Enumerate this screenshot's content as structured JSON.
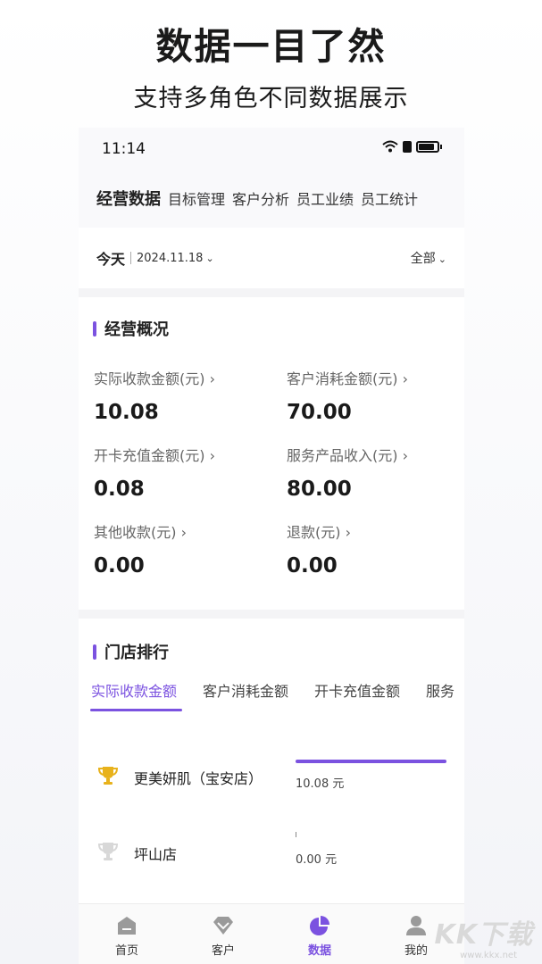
{
  "promo": {
    "title": "数据一目了然",
    "subtitle": "支持多角色不同数据展示"
  },
  "status_bar": {
    "time": "11:14",
    "icons": [
      "wifi-icon",
      "lock-icon",
      "battery-icon"
    ]
  },
  "top_tabs": [
    {
      "label": "经营数据",
      "active": true
    },
    {
      "label": "目标管理",
      "active": false
    },
    {
      "label": "客户分析",
      "active": false
    },
    {
      "label": "员工业绩",
      "active": false
    },
    {
      "label": "员工统计",
      "active": false
    }
  ],
  "date_bar": {
    "today": "今天",
    "date": "2024.11.18",
    "filter": "全部"
  },
  "overview": {
    "title": "经营概况",
    "metrics": [
      {
        "label": "实际收款金额(元) ›",
        "value": "10.08"
      },
      {
        "label": "客户消耗金额(元) ›",
        "value": "70.00"
      },
      {
        "label": "开卡充值金额(元) ›",
        "value": "0.08"
      },
      {
        "label": "服务产品收入(元) ›",
        "value": "80.00"
      },
      {
        "label": "其他收款(元) ›",
        "value": "0.00"
      },
      {
        "label": "退款(元) ›",
        "value": "0.00"
      }
    ]
  },
  "ranking": {
    "title": "门店排行",
    "tabs": [
      "实际收款金额",
      "客户消耗金额",
      "开卡充值金额",
      "服务"
    ],
    "active_tab": 0,
    "rows": [
      {
        "store": "更美妍肌（宝安店）",
        "amount": "10.08 元",
        "bar_fraction": 1.0,
        "trophy": "gold-trophy-icon"
      },
      {
        "store": "坪山店",
        "amount": "0.00 元",
        "bar_fraction": 0.0,
        "trophy": "silver-trophy-icon"
      }
    ]
  },
  "bottom_nav": [
    {
      "label": "首页",
      "icon": "home-icon",
      "active": false
    },
    {
      "label": "客户",
      "icon": "diamond-icon",
      "active": false
    },
    {
      "label": "数据",
      "icon": "pie-chart-icon",
      "active": true
    },
    {
      "label": "我的",
      "icon": "user-icon",
      "active": false
    }
  ],
  "watermark": {
    "text": "KK下载",
    "url": "www.kkx.net"
  },
  "colors": {
    "accent": "#7b52e0",
    "gold": "#e8b21c",
    "silver": "#d8d8d8"
  }
}
